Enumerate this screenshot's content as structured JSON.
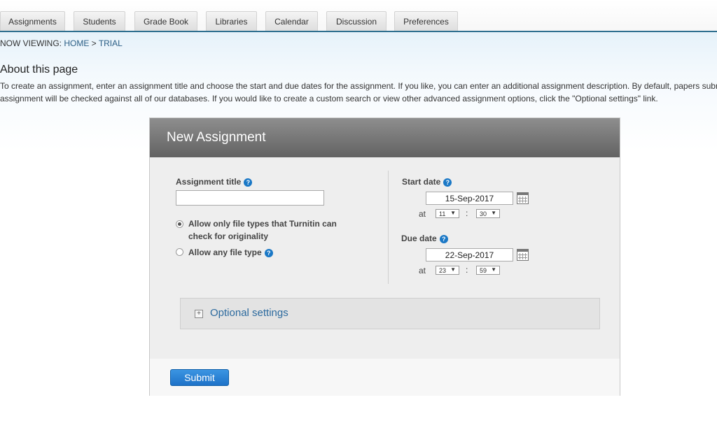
{
  "tabs": [
    "Assignments",
    "Students",
    "Grade Book",
    "Libraries",
    "Calendar",
    "Discussion",
    "Preferences"
  ],
  "breadcrumb": {
    "prefix": "NOW VIEWING: ",
    "home": "HOME",
    "separator": " > ",
    "current": "TRIAL"
  },
  "about": {
    "title": "About this page",
    "line1": "To create an assignment, enter an assignment title and choose the start and due dates for the assignment. If you like, you can enter an additional assignment description. By default, papers submitted to this",
    "line2": "assignment will be checked against all of our databases. If you would like to create a custom search or view other advanced assignment options, click the \"Optional settings\" link."
  },
  "form": {
    "header": "New Assignment",
    "title_label": "Assignment title",
    "title_value": "",
    "radio_option1_line1": "Allow only file types that Turnitin can",
    "radio_option1_line2": "check for originality",
    "radio_option2": "Allow any file type",
    "start": {
      "label": "Start date",
      "date": "15-Sep-2017",
      "at": "at",
      "hour": "11",
      "minute": "30",
      "colon": ":"
    },
    "due": {
      "label": "Due date",
      "date": "22-Sep-2017",
      "at": "at",
      "hour": "23",
      "minute": "59",
      "colon": ":"
    },
    "optional_settings": "Optional settings",
    "submit": "Submit"
  },
  "icons": {
    "help": "?",
    "expand": "+",
    "dropdown": "▼"
  },
  "colors": {
    "accent": "#1a78c6",
    "link": "#2c6a9e",
    "header_dark": "#626262"
  }
}
